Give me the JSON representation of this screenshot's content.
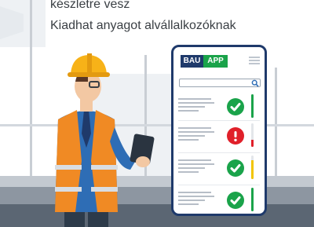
{
  "text": {
    "line1": "készletre vesz",
    "line2": "Kiadhat anyagot alvállalkozóknak"
  },
  "app": {
    "logo_left": "BAU",
    "logo_right": "APP",
    "menu_icon": "hamburger-menu-icon",
    "search_icon": "search-icon",
    "items": [
      {
        "status": "approved",
        "icon": "check-circle-icon",
        "level": 1.0,
        "level_color": "#1aa34a"
      },
      {
        "status": "warning",
        "icon": "exclamation-circle-icon",
        "level": 0.3,
        "level_color": "#e0202a"
      },
      {
        "status": "approved",
        "icon": "check-circle-icon",
        "level": 0.8,
        "level_color": "#f2c500"
      },
      {
        "status": "approved",
        "icon": "check-circle-icon",
        "level": 1.0,
        "level_color": "#1aa34a"
      }
    ]
  },
  "colors": {
    "brand_blue": "#1f3a6b",
    "brand_green": "#1aa34a",
    "ok_green": "#1aa34a",
    "alert_red": "#e0202a",
    "text": "#3a3f44"
  }
}
